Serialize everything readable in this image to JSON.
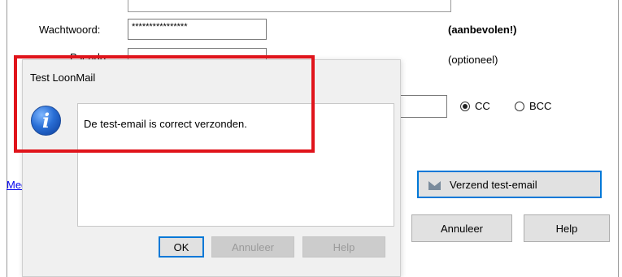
{
  "background_window": {
    "password_label": "Wachtwoord:",
    "password_value": "****************",
    "password_note": "(aanbevolen!)",
    "second_label": "Pseudo:",
    "second_note": "(optioneel)",
    "cc_label": "CC",
    "bcc_label": "BCC",
    "cc_selected": true,
    "link_text": "Mee",
    "send_test_button": "Verzend test-email",
    "cancel_button": "Annuleer",
    "help_button": "Help"
  },
  "dialog": {
    "title": "Test LoonMail",
    "icon": "info-icon",
    "message": "De test-email is correct verzonden.",
    "ok_button": "OK",
    "cancel_button": "Annuleer",
    "help_button": "Help"
  },
  "colors": {
    "highlight": "#e0141b",
    "focus_border": "#0078d7",
    "dialog_bg": "#f0f0f0"
  }
}
